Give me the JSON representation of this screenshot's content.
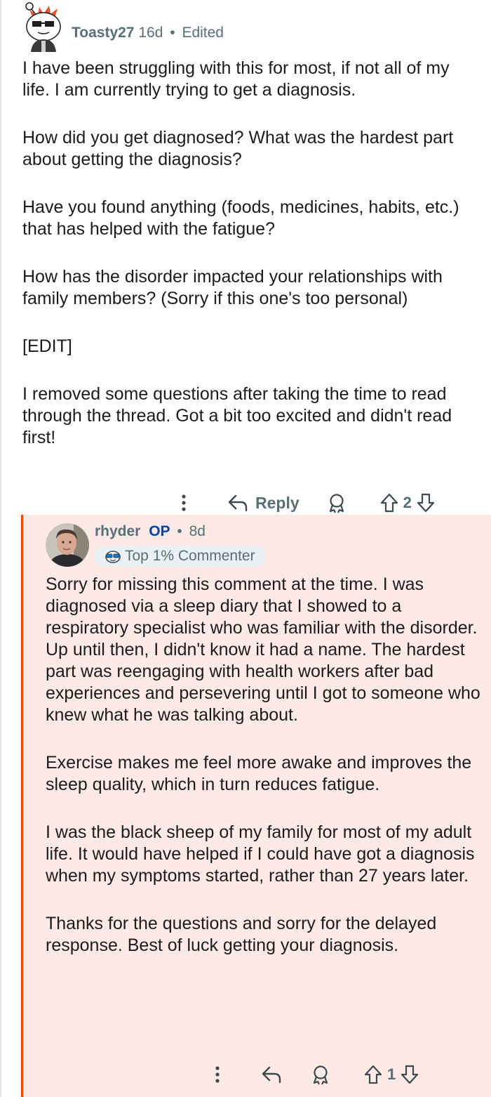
{
  "comment": {
    "username": "Toasty27",
    "age": "16d",
    "edited": "Edited",
    "paragraphs": [
      "I have been struggling with this for most, if not all of my life. I am currently trying to get a diagnosis.",
      "How did you get diagnosed? What was the hardest part about getting the diagnosis?",
      "Have you found anything (foods, medicines, habits, etc.) that has helped with the fatigue?",
      "How has the disorder impacted your relationships with family members? (Sorry if this one's too personal)",
      "[EDIT]",
      "I removed some questions after taking the time to read through the thread. Got a bit too excited and didn't read first!"
    ],
    "actions": {
      "reply_label": "Reply",
      "vote_count": "2"
    }
  },
  "reply": {
    "username": "rhyder",
    "op_tag": "OP",
    "age": "8d",
    "badge": "Top 1% Commenter",
    "paragraphs": [
      "Sorry for missing this comment at the time. I was diagnosed via a sleep diary that I showed to a respiratory specialist who was familiar with the disorder. Up until then, I didn't know it had a name. The hardest part was reengaging with health workers after bad experiences and persevering until I got to someone who knew what he was talking about.",
      "Exercise makes me feel more awake and improves the sleep quality, which in turn reduces fatigue.",
      "I was the black sheep of my family for most of my adult life. It would have helped if I could have got a diagnosis when my symptoms started, rather than 27 years later.",
      "Thanks for the questions and sorry for the delayed response. Best of luck getting your diagnosis."
    ],
    "actions": {
      "vote_count": "1"
    }
  },
  "colors": {
    "accent": "#ff4500",
    "reply_background": "#fdeae6",
    "meta_text": "#576f76",
    "op_tag": "#0a449b"
  }
}
